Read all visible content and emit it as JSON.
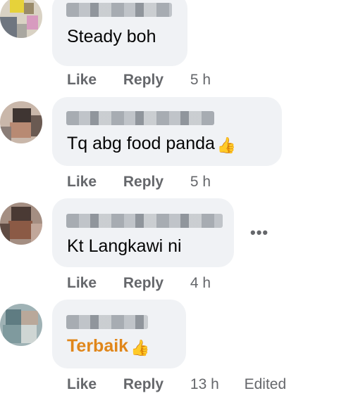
{
  "comments": [
    {
      "text": "Steady boh",
      "actions": {
        "like": "Like",
        "reply": "Reply",
        "time": "5 h"
      }
    },
    {
      "text": "Tq abg food panda",
      "emoji": "👍",
      "actions": {
        "like": "Like",
        "reply": "Reply",
        "time": "5 h"
      }
    },
    {
      "text": "Kt Langkawi ni",
      "more": "•••",
      "actions": {
        "like": "Like",
        "reply": "Reply",
        "time": "4 h"
      }
    },
    {
      "text": "Terbaik",
      "emoji": "👍",
      "actions": {
        "like": "Like",
        "reply": "Reply",
        "time": "13 h",
        "edited": "Edited"
      }
    }
  ],
  "colors": {
    "bubble": "#f0f2f5",
    "action_text": "#65676b",
    "highlight_text": "#e0861a"
  },
  "icons": {
    "thumbs_up": "thumbs-up-icon",
    "more": "more-options-icon"
  }
}
